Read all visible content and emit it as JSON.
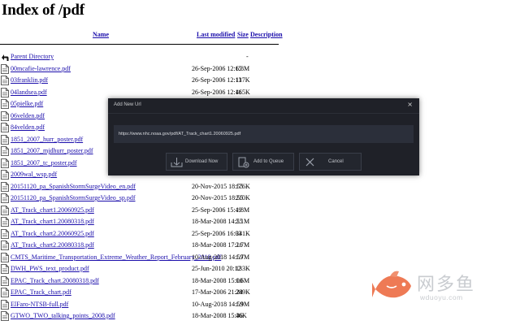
{
  "page": {
    "title": "Index of /pdf"
  },
  "columns": {
    "name": "Name",
    "last_modified": "Last modified",
    "size": "Size",
    "description": "Description"
  },
  "parent": {
    "label": "Parent Directory",
    "size": "-"
  },
  "files": [
    {
      "name": "00mcafie-lawrence.pdf",
      "date": "26-Sep-2006 12:15",
      "size": "6.8M"
    },
    {
      "name": "03franklin.pdf",
      "date": "26-Sep-2006 12:13",
      "size": "117K"
    },
    {
      "name": "04landsea.pdf",
      "date": "26-Sep-2006 12:11",
      "size": "465K"
    },
    {
      "name": "05pielke.pdf",
      "date": "",
      "size": ""
    },
    {
      "name": "06velden.pdf",
      "date": "",
      "size": ""
    },
    {
      "name": "84velden.pdf",
      "date": "",
      "size": ""
    },
    {
      "name": "1851_2007_hurr_poster.pdf",
      "date": "",
      "size": ""
    },
    {
      "name": "1851_2007_mjdhurr_poster.pdf",
      "date": "",
      "size": ""
    },
    {
      "name": "1851_2007_tc_poster.pdf",
      "date": "",
      "size": ""
    },
    {
      "name": "2009wal_wsp.pdf",
      "date": "",
      "size": ""
    },
    {
      "name": "20151120_pa_SpanishStormSurgeVideo_en.pdf",
      "date": "20-Nov-2015 18:55",
      "size": "176K"
    },
    {
      "name": "20151120_pa_SpanishStormSurgeVideo_sp.pdf",
      "date": "20-Nov-2015 18:55",
      "size": "210K"
    },
    {
      "name": "AT_Track_chart1.20060925.pdf",
      "date": "25-Sep-2006 15:49",
      "size": "1.8M"
    },
    {
      "name": "AT_Track_chart1.20080318.pdf",
      "date": "18-Mar-2008 14:55",
      "size": "2.1M"
    },
    {
      "name": "AT_Track_chart2.20060925.pdf",
      "date": "25-Sep-2006 16:03",
      "size": "341K"
    },
    {
      "name": "AT_Track_chart2.20080318.pdf",
      "date": "18-Mar-2008 17:16",
      "size": "2.7M"
    },
    {
      "name": "CMTS_Maritime_Transportation_Extreme_Weather_Report_February_2018.pdf",
      "date": "10-Aug-2018 14:59",
      "size": "1.7M"
    },
    {
      "name": "DWH_PWS_text_product.pdf",
      "date": "25-Jun-2010 20:12",
      "size": "133K"
    },
    {
      "name": "EPAC_Track_chart.20080318.pdf",
      "date": "18-Mar-2008 15:00",
      "size": "1.6M"
    },
    {
      "name": "EPAC_Track_chart.pdf",
      "date": "17-Mar-2006 21:24",
      "size": "289K"
    },
    {
      "name": "ElFaro-NTSB-full.pdf",
      "date": "10-Aug-2018 14:59",
      "size": "1.9M"
    },
    {
      "name": "GTWO_TWO_talking_points_2008.pdf",
      "date": "18-Mar-2008 15:36",
      "size": "46K"
    }
  ],
  "dialog": {
    "title": "Add New Url",
    "close": "×",
    "url": "https://www.nhc.noaa.gov/pdf/AT_Track_chart1.20060925.pdf",
    "download_label": "Download Now",
    "queue_label": "Add to Queue",
    "cancel_label": "Cancel"
  },
  "watermark": {
    "cn": "网多鱼",
    "en": "wduoyu.com"
  },
  "colors": {
    "link": "#1a0dab",
    "dialog_bg": "#1f2128",
    "dialog_field": "#2b2f3a",
    "watermark_fish": "#ee7a55"
  }
}
